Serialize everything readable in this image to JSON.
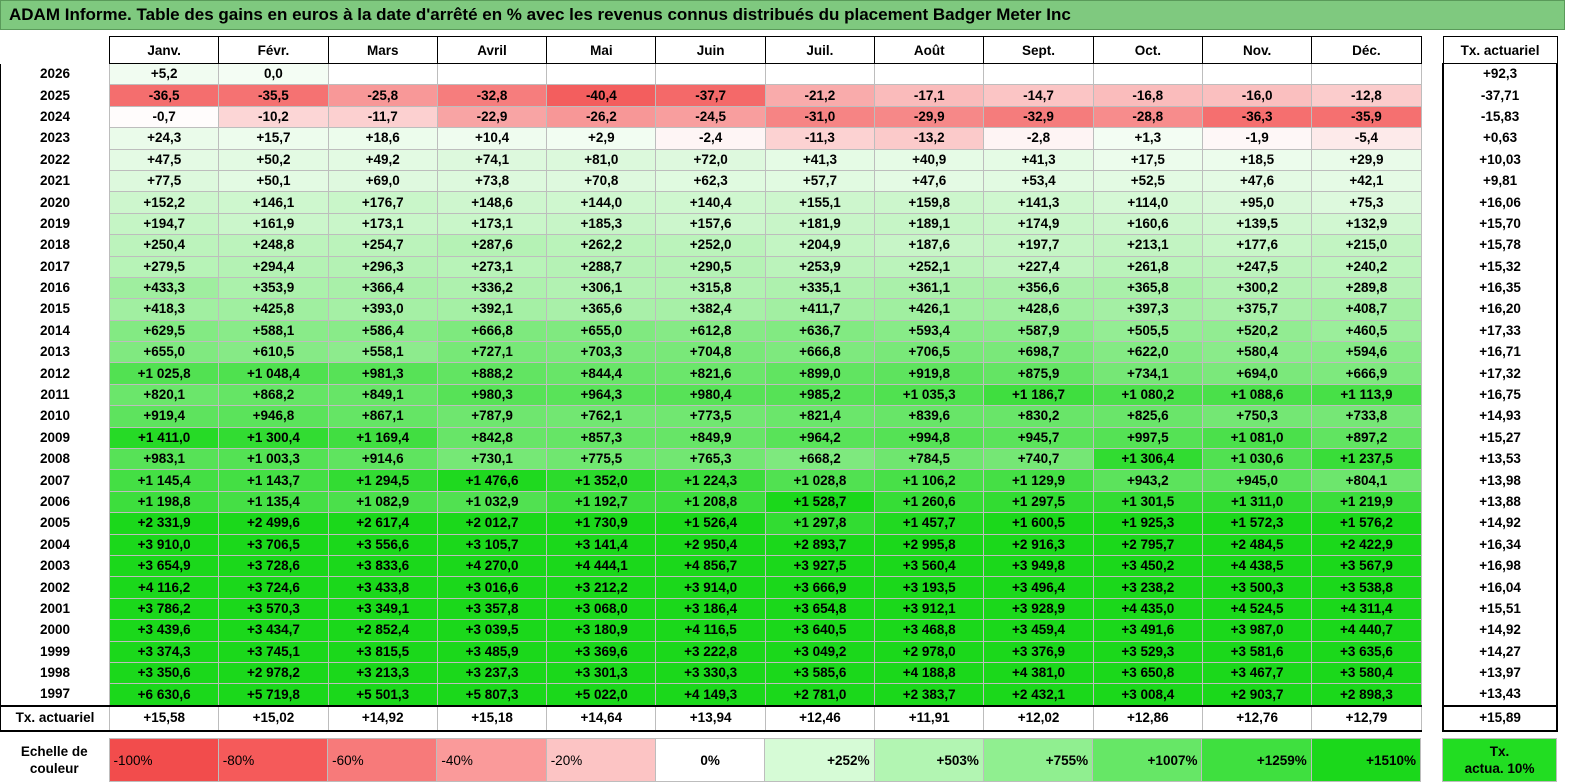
{
  "title": "ADAM Informe. Table des gains en euros à la date d'arrêté en % avec les revenus connus distribués du placement Badger Meter Inc",
  "months": [
    "Janv.",
    "Févr.",
    "Mars",
    "Avril",
    "Mai",
    "Juin",
    "Juil.",
    "Août",
    "Sept.",
    "Oct.",
    "Nov.",
    "Déc."
  ],
  "actuarial_header": "Tx. actuariel",
  "rows": [
    {
      "year": "2026",
      "vals": [
        "+5,2",
        "0,0",
        "",
        "",
        "",
        "",
        "",
        "",
        "",
        "",
        "",
        ""
      ],
      "act": "+92,3"
    },
    {
      "year": "2025",
      "vals": [
        "-36,5",
        "-35,5",
        "-25,8",
        "-32,8",
        "-40,4",
        "-37,7",
        "-21,2",
        "-17,1",
        "-14,7",
        "-16,8",
        "-16,0",
        "-12,8"
      ],
      "act": "-37,71"
    },
    {
      "year": "2024",
      "vals": [
        "-0,7",
        "-10,2",
        "-11,7",
        "-22,9",
        "-26,2",
        "-24,5",
        "-31,0",
        "-29,9",
        "-32,9",
        "-28,8",
        "-36,3",
        "-35,9"
      ],
      "act": "-15,83"
    },
    {
      "year": "2023",
      "vals": [
        "+24,3",
        "+15,7",
        "+18,6",
        "+10,4",
        "+2,9",
        "-2,4",
        "-11,3",
        "-13,2",
        "-2,8",
        "+1,3",
        "-1,9",
        "-5,4"
      ],
      "act": "+0,63"
    },
    {
      "year": "2022",
      "vals": [
        "+47,5",
        "+50,2",
        "+49,2",
        "+74,1",
        "+81,0",
        "+72,0",
        "+41,3",
        "+40,9",
        "+41,3",
        "+17,5",
        "+18,5",
        "+29,9"
      ],
      "act": "+10,03"
    },
    {
      "year": "2021",
      "vals": [
        "+77,5",
        "+50,1",
        "+69,0",
        "+73,8",
        "+70,8",
        "+62,3",
        "+57,7",
        "+47,6",
        "+53,4",
        "+52,5",
        "+47,6",
        "+42,1"
      ],
      "act": "+9,81"
    },
    {
      "year": "2020",
      "vals": [
        "+152,2",
        "+146,1",
        "+176,7",
        "+148,6",
        "+144,0",
        "+140,4",
        "+155,1",
        "+159,8",
        "+141,3",
        "+114,0",
        "+95,0",
        "+75,3"
      ],
      "act": "+16,06"
    },
    {
      "year": "2019",
      "vals": [
        "+194,7",
        "+161,9",
        "+173,1",
        "+173,1",
        "+185,3",
        "+157,6",
        "+181,9",
        "+189,1",
        "+174,9",
        "+160,6",
        "+139,5",
        "+132,9"
      ],
      "act": "+15,70"
    },
    {
      "year": "2018",
      "vals": [
        "+250,4",
        "+248,8",
        "+254,7",
        "+287,6",
        "+262,2",
        "+252,0",
        "+204,9",
        "+187,6",
        "+197,7",
        "+213,1",
        "+177,6",
        "+215,0"
      ],
      "act": "+15,78"
    },
    {
      "year": "2017",
      "vals": [
        "+279,5",
        "+294,4",
        "+296,3",
        "+273,1",
        "+288,7",
        "+290,5",
        "+253,9",
        "+252,1",
        "+227,4",
        "+261,8",
        "+247,5",
        "+240,2"
      ],
      "act": "+15,32"
    },
    {
      "year": "2016",
      "vals": [
        "+433,3",
        "+353,9",
        "+366,4",
        "+336,2",
        "+306,1",
        "+315,8",
        "+335,1",
        "+361,1",
        "+356,6",
        "+365,8",
        "+300,2",
        "+289,8"
      ],
      "act": "+16,35"
    },
    {
      "year": "2015",
      "vals": [
        "+418,3",
        "+425,8",
        "+393,0",
        "+392,1",
        "+365,6",
        "+382,4",
        "+411,7",
        "+426,1",
        "+428,6",
        "+397,3",
        "+375,7",
        "+408,7"
      ],
      "act": "+16,20"
    },
    {
      "year": "2014",
      "vals": [
        "+629,5",
        "+588,1",
        "+586,4",
        "+666,8",
        "+655,0",
        "+612,8",
        "+636,7",
        "+593,4",
        "+587,9",
        "+505,5",
        "+520,2",
        "+460,5"
      ],
      "act": "+17,33"
    },
    {
      "year": "2013",
      "vals": [
        "+655,0",
        "+610,5",
        "+558,1",
        "+727,1",
        "+703,3",
        "+704,8",
        "+666,8",
        "+706,5",
        "+698,7",
        "+622,0",
        "+580,4",
        "+594,6"
      ],
      "act": "+16,71"
    },
    {
      "year": "2012",
      "vals": [
        "+1 025,8",
        "+1 048,4",
        "+981,3",
        "+888,2",
        "+844,4",
        "+821,6",
        "+899,0",
        "+919,8",
        "+875,9",
        "+734,1",
        "+694,0",
        "+666,9"
      ],
      "act": "+17,32"
    },
    {
      "year": "2011",
      "vals": [
        "+820,1",
        "+868,2",
        "+849,1",
        "+980,3",
        "+964,3",
        "+980,4",
        "+985,2",
        "+1 035,3",
        "+1 186,7",
        "+1 080,2",
        "+1 088,6",
        "+1 113,9"
      ],
      "act": "+16,75"
    },
    {
      "year": "2010",
      "vals": [
        "+919,4",
        "+946,8",
        "+867,1",
        "+787,9",
        "+762,1",
        "+773,5",
        "+821,4",
        "+839,6",
        "+830,2",
        "+825,6",
        "+750,3",
        "+733,8"
      ],
      "act": "+14,93"
    },
    {
      "year": "2009",
      "vals": [
        "+1 411,0",
        "+1 300,4",
        "+1 169,4",
        "+842,8",
        "+857,3",
        "+849,9",
        "+964,2",
        "+994,8",
        "+945,7",
        "+997,5",
        "+1 081,0",
        "+897,2"
      ],
      "act": "+15,27"
    },
    {
      "year": "2008",
      "vals": [
        "+983,1",
        "+1 003,3",
        "+914,6",
        "+730,1",
        "+775,5",
        "+765,3",
        "+668,2",
        "+784,5",
        "+740,7",
        "+1 306,4",
        "+1 030,6",
        "+1 237,5"
      ],
      "act": "+13,53"
    },
    {
      "year": "2007",
      "vals": [
        "+1 145,4",
        "+1 143,7",
        "+1 294,5",
        "+1 476,6",
        "+1 352,0",
        "+1 224,3",
        "+1 028,8",
        "+1 106,2",
        "+1 129,9",
        "+943,2",
        "+945,0",
        "+804,1"
      ],
      "act": "+13,98"
    },
    {
      "year": "2006",
      "vals": [
        "+1 198,8",
        "+1 135,4",
        "+1 082,9",
        "+1 032,9",
        "+1 192,7",
        "+1 208,8",
        "+1 528,7",
        "+1 260,6",
        "+1 297,5",
        "+1 301,5",
        "+1 311,0",
        "+1 219,9"
      ],
      "act": "+13,88"
    },
    {
      "year": "2005",
      "vals": [
        "+2 331,9",
        "+2 499,6",
        "+2 617,4",
        "+2 012,7",
        "+1 730,9",
        "+1 526,4",
        "+1 297,8",
        "+1 457,7",
        "+1 600,5",
        "+1 925,3",
        "+1 572,3",
        "+1 576,2"
      ],
      "act": "+14,92"
    },
    {
      "year": "2004",
      "vals": [
        "+3 910,0",
        "+3 706,5",
        "+3 556,6",
        "+3 105,7",
        "+3 141,4",
        "+2 950,4",
        "+2 893,7",
        "+2 995,8",
        "+2 916,3",
        "+2 795,7",
        "+2 484,5",
        "+2 422,9"
      ],
      "act": "+16,34"
    },
    {
      "year": "2003",
      "vals": [
        "+3 654,9",
        "+3 728,6",
        "+3 833,6",
        "+4 270,0",
        "+4 444,1",
        "+4 856,7",
        "+3 927,5",
        "+3 560,4",
        "+3 949,8",
        "+3 450,2",
        "+4 438,5",
        "+3 567,9"
      ],
      "act": "+16,98"
    },
    {
      "year": "2002",
      "vals": [
        "+4 116,2",
        "+3 724,6",
        "+3 433,8",
        "+3 016,6",
        "+3 212,2",
        "+3 914,0",
        "+3 666,9",
        "+3 193,5",
        "+3 496,4",
        "+3 238,2",
        "+3 500,3",
        "+3 538,8"
      ],
      "act": "+16,04"
    },
    {
      "year": "2001",
      "vals": [
        "+3 786,2",
        "+3 570,3",
        "+3 349,1",
        "+3 357,8",
        "+3 068,0",
        "+3 186,4",
        "+3 654,8",
        "+3 912,1",
        "+3 928,9",
        "+4 435,0",
        "+4 524,5",
        "+4 311,4"
      ],
      "act": "+15,51"
    },
    {
      "year": "2000",
      "vals": [
        "+3 439,6",
        "+3 434,7",
        "+2 852,4",
        "+3 039,5",
        "+3 180,9",
        "+4 116,5",
        "+3 640,5",
        "+3 468,8",
        "+3 459,4",
        "+3 491,6",
        "+3 987,0",
        "+4 440,7"
      ],
      "act": "+14,92"
    },
    {
      "year": "1999",
      "vals": [
        "+3 374,3",
        "+3 745,1",
        "+3 815,5",
        "+3 485,9",
        "+3 369,6",
        "+3 222,8",
        "+3 049,2",
        "+2 978,0",
        "+3 376,9",
        "+3 529,3",
        "+3 581,6",
        "+3 635,6"
      ],
      "act": "+14,27"
    },
    {
      "year": "1998",
      "vals": [
        "+3 350,6",
        "+2 978,2",
        "+3 213,3",
        "+3 237,3",
        "+3 301,3",
        "+3 330,3",
        "+3 585,6",
        "+4 188,8",
        "+4 381,0",
        "+3 650,8",
        "+3 467,7",
        "+3 580,4"
      ],
      "act": "+13,97"
    },
    {
      "year": "1997",
      "vals": [
        "+6 630,6",
        "+5 719,8",
        "+5 501,3",
        "+5 807,3",
        "+5 022,0",
        "+4 149,3",
        "+2 781,0",
        "+2 383,7",
        "+2 432,1",
        "+3 008,4",
        "+2 903,7",
        "+2 898,3"
      ],
      "act": "+13,43"
    }
  ],
  "totals": {
    "label": "Tx. actuariel",
    "vals": [
      "+15,58",
      "+15,02",
      "+14,92",
      "+15,18",
      "+14,64",
      "+13,94",
      "+12,46",
      "+11,91",
      "+12,02",
      "+12,86",
      "+12,76",
      "+12,79"
    ],
    "act": "+15,89"
  },
  "scale": {
    "label_line1": "Echelle de",
    "label_line2": "couleur",
    "items": [
      {
        "text": "-100%",
        "color": "#f24c4c",
        "align": "left"
      },
      {
        "text": "-80%",
        "color": "#f55a5a",
        "align": "left"
      },
      {
        "text": "-60%",
        "color": "#f77a7a",
        "align": "left"
      },
      {
        "text": "-40%",
        "color": "#fa9a9a",
        "align": "left"
      },
      {
        "text": "-20%",
        "color": "#fcc4c4",
        "align": "left"
      },
      {
        "text": "0%",
        "color": "#ffffff",
        "align": "center"
      },
      {
        "text": "+252%",
        "color": "#d6fbd6",
        "align": "right"
      },
      {
        "text": "+503%",
        "color": "#b2f5b2",
        "align": "right"
      },
      {
        "text": "+755%",
        "color": "#90ef90",
        "align": "right"
      },
      {
        "text": "+1007%",
        "color": "#66e766",
        "align": "right"
      },
      {
        "text": "+1259%",
        "color": "#3fe03f",
        "align": "right"
      },
      {
        "text": "+1510%",
        "color": "#1bd81b",
        "align": "right"
      }
    ],
    "last_line1": "Tx.",
    "last_line2": "actua. 10%",
    "last_color": "#22dd22"
  }
}
